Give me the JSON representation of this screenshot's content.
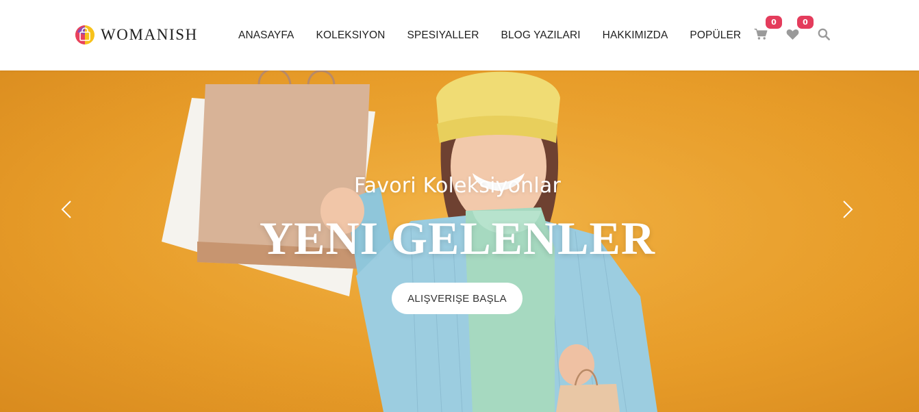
{
  "brand": {
    "name": "WOMANISH",
    "colors": {
      "badge": "#e43c5c",
      "hero_bg": "#e89d2a",
      "text_dark": "#1f1f1f",
      "icon_gray": "#9a9a9a"
    }
  },
  "nav": {
    "items": [
      {
        "label": "ANASAYFA"
      },
      {
        "label": "KOLEKSIYON"
      },
      {
        "label": "SPESIYALLER"
      },
      {
        "label": "BLOG YAZILARI"
      },
      {
        "label": "HAKKIMIZDA"
      },
      {
        "label": "POPÜLER"
      }
    ]
  },
  "header_icons": {
    "cart": {
      "icon": "cart-icon",
      "count": "0"
    },
    "wishlist": {
      "icon": "heart-icon",
      "count": "0"
    },
    "search": {
      "icon": "search-icon"
    }
  },
  "hero": {
    "subtitle": "Favori Koleksiyonlar",
    "title": "YENI GELENLER",
    "cta_label": "ALIŞVERIŞE BAŞLA",
    "prev_icon": "chevron-left-icon",
    "next_icon": "chevron-right-icon"
  }
}
